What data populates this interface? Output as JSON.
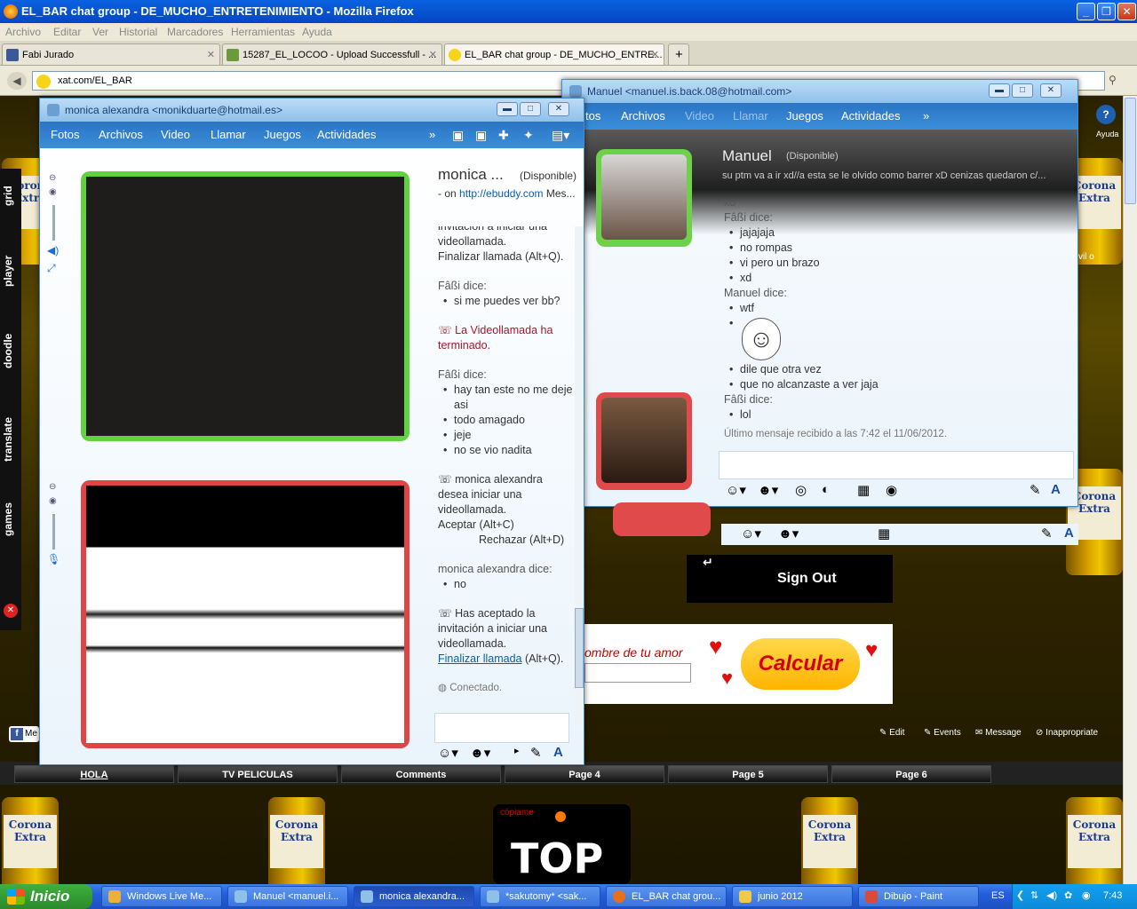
{
  "firefox": {
    "title": "EL_BAR chat group - DE_MUCHO_ENTRETENIMIENTO - Mozilla Firefox",
    "menu": [
      "Archivo",
      "Editar",
      "Ver",
      "Historial",
      "Marcadores",
      "Herramientas",
      "Ayuda"
    ],
    "tabs": [
      {
        "label": "Fabi Jurado",
        "icon": "facebook-icon"
      },
      {
        "label": "15287_EL_LOCOO - Upload Successfull - ...",
        "icon": "upload-icon"
      },
      {
        "label": "EL_BAR chat group - DE_MUCHO_ENTRE...",
        "icon": "smiley-icon"
      }
    ],
    "new_tab": "+",
    "url": "xat.com/EL_BAR"
  },
  "xat_sidebar": [
    "grid",
    "player",
    "doodle",
    "translate",
    "games"
  ],
  "msn_monica": {
    "title": "monica alexandra <monikduarte@hotmail.es>",
    "menu": [
      "Fotos",
      "Archivos",
      "Video",
      "Llamar",
      "Juegos",
      "Actividades"
    ],
    "contact_name": "monica ...",
    "status": "(Disponible)",
    "sub_prefix": "- on",
    "sub_link": "http://ebuddy.com",
    "sub_suffix": "Mes...",
    "chat": {
      "l1": "invitación a iniciar una",
      "l2": "videollamada.",
      "l3": "Finalizar llamada (Alt+Q).",
      "fabi1": "Fâßi dice:",
      "fabi1_items": [
        "si me puedes ver bb?"
      ],
      "ended": "La Videollamada ha terminado.",
      "fabi2": "Fâßi dice:",
      "fabi2_items": [
        "hay tan este no me deje asi",
        "todo amagado",
        "jeje",
        "no se vio nadita"
      ],
      "invite1": "monica alexandra desea iniciar una videollamada.",
      "accept": "Aceptar (Alt+C)",
      "reject": "Rechazar (Alt+D)",
      "monica_says": "monica alexandra dice:",
      "monica_items": [
        "no"
      ],
      "accepted": "Has aceptado la invitación a iniciar una videollamada.",
      "end_link": "Finalizar llamada",
      "end_key": "(Alt+Q).",
      "connected": "Conectado."
    }
  },
  "msn_manuel": {
    "title": "Manuel <manuel.is.back.08@hotmail.com>",
    "menu": [
      "Fotos",
      "Archivos",
      "Video",
      "Llamar",
      "Juegos",
      "Actividades"
    ],
    "contact_name": "Manuel",
    "status": "(Disponible)",
    "personal_msg": "su ptm va a ir xd//a esta se le olvido como barrer xD cenizas quedaron c/...",
    "chat": {
      "cut": "xd",
      "fabi1": "Fâßi dice:",
      "fabi1_items": [
        "jajajaja",
        "no rompas",
        "vi pero un brazo",
        "xd"
      ],
      "manuel": "Manuel dice:",
      "manuel_items": [
        "wtf",
        "",
        "dile que otra vez",
        "que no alcanzaste a ver jaja"
      ],
      "fabi2": "Fâßi dice:",
      "fabi2_items": [
        "lol"
      ],
      "last": "Último mensaje recibido a las 7:42 el 11/06/2012."
    },
    "partial_menu_text": "tos",
    "ayuda": "Ayuda",
    "partial_url": "vil o"
  },
  "xat_page": {
    "signout": "Sign Out",
    "love_text": "ombre de tu amor",
    "calc_button": "Calcular",
    "facebook_partial": "Me",
    "tools": [
      "Edit",
      "Events",
      "Message",
      "Inappropriate"
    ],
    "page_tabs": [
      "HOLA",
      "TV PELICULAS",
      "Comments",
      "Page 4",
      "Page 5",
      "Page 6"
    ],
    "top_logo": "TOP",
    "top_small": "cópiame",
    "bottle_label": "Corona",
    "bottle_sub": "Extra"
  },
  "taskbar": {
    "start": "Inicio",
    "tasks": [
      "Windows Live Me...",
      "Manuel <manuel.i...",
      "monica alexandra...",
      "*sakutomy* <sak...",
      "EL_BAR chat grou...",
      "junio 2012",
      "Dibujo - Paint"
    ],
    "lang": "ES",
    "clock": "7:43"
  }
}
